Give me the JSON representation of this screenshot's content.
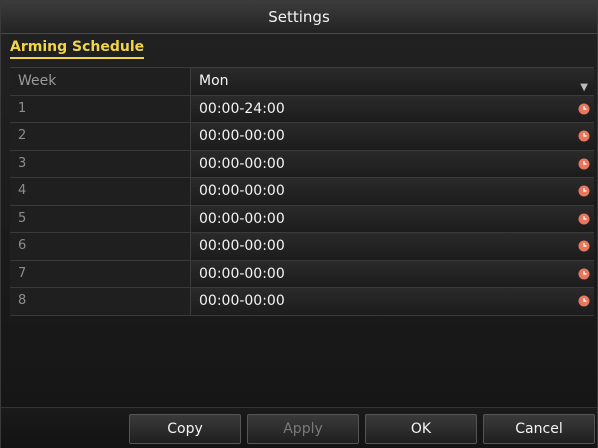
{
  "window": {
    "title": "Settings"
  },
  "tabs": [
    {
      "label": "Arming Schedule",
      "active": true
    }
  ],
  "schedule": {
    "week_label": "Week",
    "week_value": "Mon",
    "periods": [
      {
        "index": "1",
        "time": "00:00-24:00"
      },
      {
        "index": "2",
        "time": "00:00-00:00"
      },
      {
        "index": "3",
        "time": "00:00-00:00"
      },
      {
        "index": "4",
        "time": "00:00-00:00"
      },
      {
        "index": "5",
        "time": "00:00-00:00"
      },
      {
        "index": "6",
        "time": "00:00-00:00"
      },
      {
        "index": "7",
        "time": "00:00-00:00"
      },
      {
        "index": "8",
        "time": "00:00-00:00"
      }
    ]
  },
  "buttons": {
    "copy": "Copy",
    "apply": "Apply",
    "ok": "OK",
    "cancel": "Cancel"
  },
  "icons": {
    "period": "clock-icon",
    "week": "chevron-down-icon"
  },
  "colors": {
    "accent": "#f0d44a",
    "clock": "#e8775e"
  }
}
